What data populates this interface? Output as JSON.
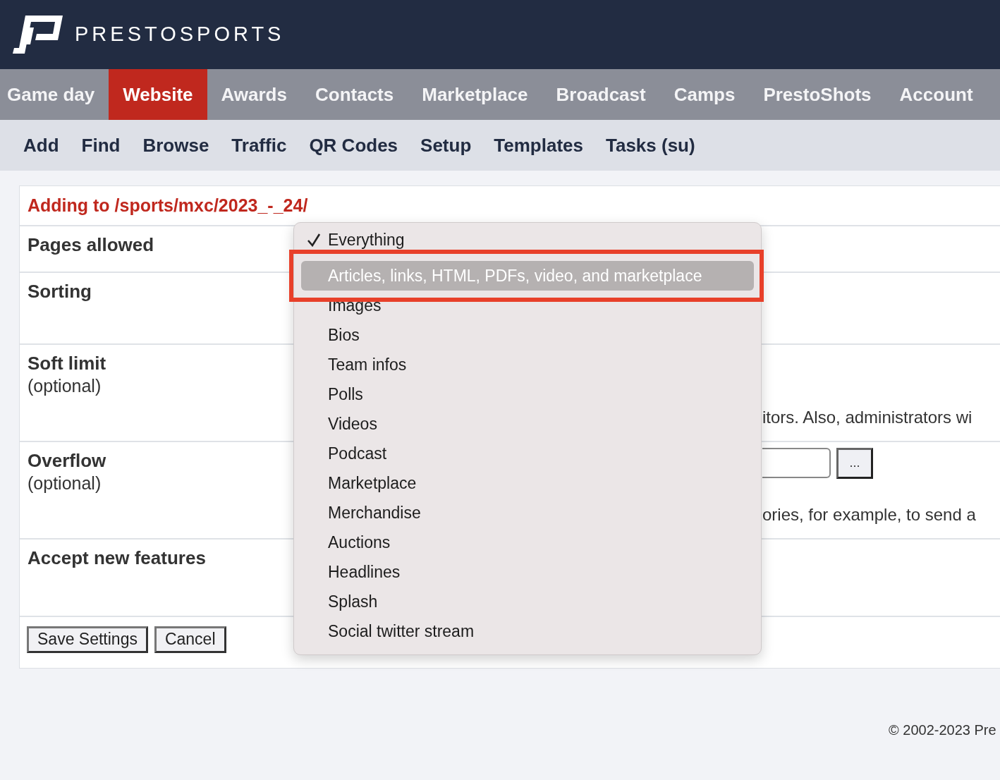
{
  "brand": {
    "name": "PRESTOSPORTS"
  },
  "main_nav": [
    {
      "label": "Game day",
      "selected": false
    },
    {
      "label": "Website",
      "selected": true
    },
    {
      "label": "Awards",
      "selected": false
    },
    {
      "label": "Contacts",
      "selected": false
    },
    {
      "label": "Marketplace",
      "selected": false
    },
    {
      "label": "Broadcast",
      "selected": false
    },
    {
      "label": "Camps",
      "selected": false
    },
    {
      "label": "PrestoShots",
      "selected": false
    },
    {
      "label": "Account",
      "selected": false
    }
  ],
  "sub_nav": [
    "Add",
    "Find",
    "Browse",
    "Traffic",
    "QR Codes",
    "Setup",
    "Templates",
    "Tasks (su)"
  ],
  "form": {
    "heading": "Adding to /sports/mxc/2023_-_24/",
    "rows": [
      {
        "label": "Pages allowed"
      },
      {
        "label": "Sorting"
      },
      {
        "label": "Soft limit",
        "note": "(optional)",
        "text": "itors. Also, administrators wi"
      },
      {
        "label": "Overflow",
        "note": "(optional)",
        "browse_button": "...",
        "text": "ories, for example, to send a"
      },
      {
        "label": "Accept new features"
      }
    ],
    "buttons": [
      "Save Settings",
      "Cancel"
    ]
  },
  "dropdown": {
    "items": [
      {
        "label": "Everything",
        "checked": true,
        "selected": false
      },
      {
        "label": "Articles, links, HTML, PDFs, video, and marketplace",
        "checked": false,
        "selected": true
      },
      {
        "label": "Images",
        "checked": false,
        "selected": false
      },
      {
        "label": "Bios",
        "checked": false,
        "selected": false
      },
      {
        "label": "Team infos",
        "checked": false,
        "selected": false
      },
      {
        "label": "Polls",
        "checked": false,
        "selected": false
      },
      {
        "label": "Videos",
        "checked": false,
        "selected": false
      },
      {
        "label": "Podcast",
        "checked": false,
        "selected": false
      },
      {
        "label": "Marketplace",
        "checked": false,
        "selected": false
      },
      {
        "label": "Merchandise",
        "checked": false,
        "selected": false
      },
      {
        "label": "Auctions",
        "checked": false,
        "selected": false
      },
      {
        "label": "Headlines",
        "checked": false,
        "selected": false
      },
      {
        "label": "Splash",
        "checked": false,
        "selected": false
      },
      {
        "label": "Social twitter stream",
        "checked": false,
        "selected": false
      }
    ]
  },
  "footer": "© 2002-2023 Pre"
}
